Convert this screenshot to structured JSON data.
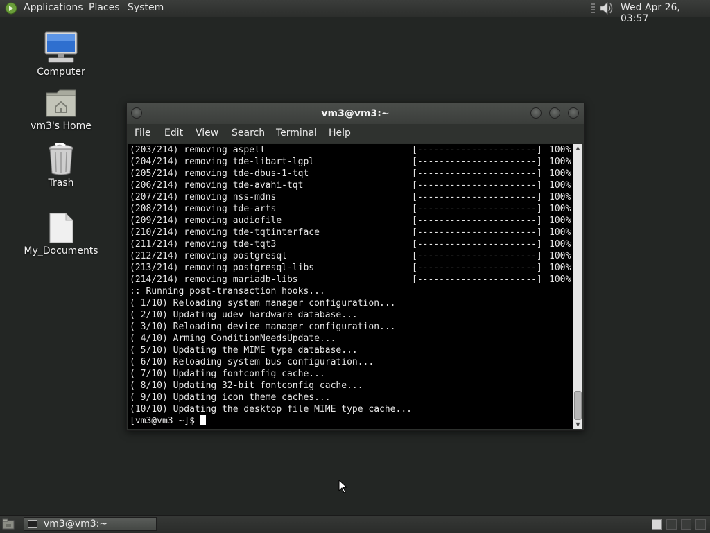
{
  "top_panel": {
    "menus": [
      "Applications",
      "Places",
      "System"
    ],
    "clock": "Wed Apr 26, 03:57",
    "icons": [
      "distro-menu-icon",
      "volume-icon"
    ]
  },
  "desktop": {
    "icons": [
      {
        "label": "Computer",
        "icon": "computer-icon"
      },
      {
        "label": "vm3's Home",
        "icon": "home-folder-icon"
      },
      {
        "label": "Trash",
        "icon": "trash-icon"
      },
      {
        "label": "My_Documents",
        "icon": "document-icon"
      }
    ]
  },
  "terminal": {
    "title": "vm3@vm3:~",
    "menu": [
      "File",
      "Edit",
      "View",
      "Search",
      "Terminal",
      "Help"
    ],
    "progress_lines": [
      {
        "text": "(203/214) removing aspell",
        "bar": "[----------------------]",
        "pct": "100%"
      },
      {
        "text": "(204/214) removing tde-libart-lgpl",
        "bar": "[----------------------]",
        "pct": "100%"
      },
      {
        "text": "(205/214) removing tde-dbus-1-tqt",
        "bar": "[----------------------]",
        "pct": "100%"
      },
      {
        "text": "(206/214) removing tde-avahi-tqt",
        "bar": "[----------------------]",
        "pct": "100%"
      },
      {
        "text": "(207/214) removing nss-mdns",
        "bar": "[----------------------]",
        "pct": "100%"
      },
      {
        "text": "(208/214) removing tde-arts",
        "bar": "[----------------------]",
        "pct": "100%"
      },
      {
        "text": "(209/214) removing audiofile",
        "bar": "[----------------------]",
        "pct": "100%"
      },
      {
        "text": "(210/214) removing tde-tqtinterface",
        "bar": "[----------------------]",
        "pct": "100%"
      },
      {
        "text": "(211/214) removing tde-tqt3",
        "bar": "[----------------------]",
        "pct": "100%"
      },
      {
        "text": "(212/214) removing postgresql",
        "bar": "[----------------------]",
        "pct": "100%"
      },
      {
        "text": "(213/214) removing postgresql-libs",
        "bar": "[----------------------]",
        "pct": "100%"
      },
      {
        "text": "(214/214) removing mariadb-libs",
        "bar": "[----------------------]",
        "pct": "100%"
      }
    ],
    "log_lines": [
      ":: Running post-transaction hooks...",
      "( 1/10) Reloading system manager configuration...",
      "( 2/10) Updating udev hardware database...",
      "( 3/10) Reloading device manager configuration...",
      "( 4/10) Arming ConditionNeedsUpdate...",
      "( 5/10) Updating the MIME type database...",
      "( 6/10) Reloading system bus configuration...",
      "( 7/10) Updating fontconfig cache...",
      "( 8/10) Updating 32-bit fontconfig cache...",
      "( 9/10) Updating icon theme caches...",
      "(10/10) Updating the desktop file MIME type cache..."
    ],
    "prompt": "[vm3@vm3 ~]$ "
  },
  "bottom_panel": {
    "task_label": "vm3@vm3:~",
    "workspaces": 4,
    "active_workspace": 1
  },
  "colors": {
    "desktop_bg": "#232624",
    "panel_bg": "#333533",
    "terminal_bg": "#000000",
    "terminal_fg": "#e6e6e6"
  }
}
